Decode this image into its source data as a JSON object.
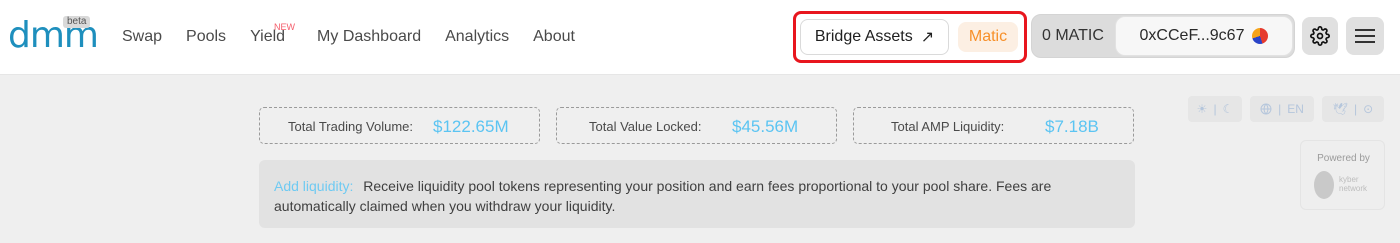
{
  "logo": {
    "text": "dmm",
    "badge": "beta"
  },
  "nav": {
    "items": [
      {
        "label": "Swap"
      },
      {
        "label": "Pools"
      },
      {
        "label": "Yield",
        "badge": "NEW"
      },
      {
        "label": "My Dashboard"
      },
      {
        "label": "Analytics"
      },
      {
        "label": "About"
      }
    ]
  },
  "header": {
    "bridge_label": "Bridge Assets",
    "bridge_arrow": "↗",
    "network_label": "Matic",
    "wallet_balance": "0 MATIC",
    "wallet_address": "0xCCeF...9c67"
  },
  "stats": [
    {
      "label": "Total Trading Volume:",
      "value": "$122.65M"
    },
    {
      "label": "Total Value Locked:",
      "value": "$45.56M"
    },
    {
      "label": "Total AMP Liquidity:",
      "value": "$7.18B"
    }
  ],
  "info": {
    "link": "Add liquidity:",
    "text": "Receive liquidity pool tokens representing your position and earn fees proportional to your pool share. Fees are automatically claimed when you withdraw your liquidity."
  },
  "toolbar": {
    "language": "EN"
  },
  "powered": {
    "label": "Powered by",
    "brand_line1": "kyber",
    "brand_line2": "network"
  },
  "colors": {
    "accent": "#5bc4f2",
    "network": "#f7902a",
    "highlight": "#e8161e",
    "brand": "#1e8fbd"
  }
}
